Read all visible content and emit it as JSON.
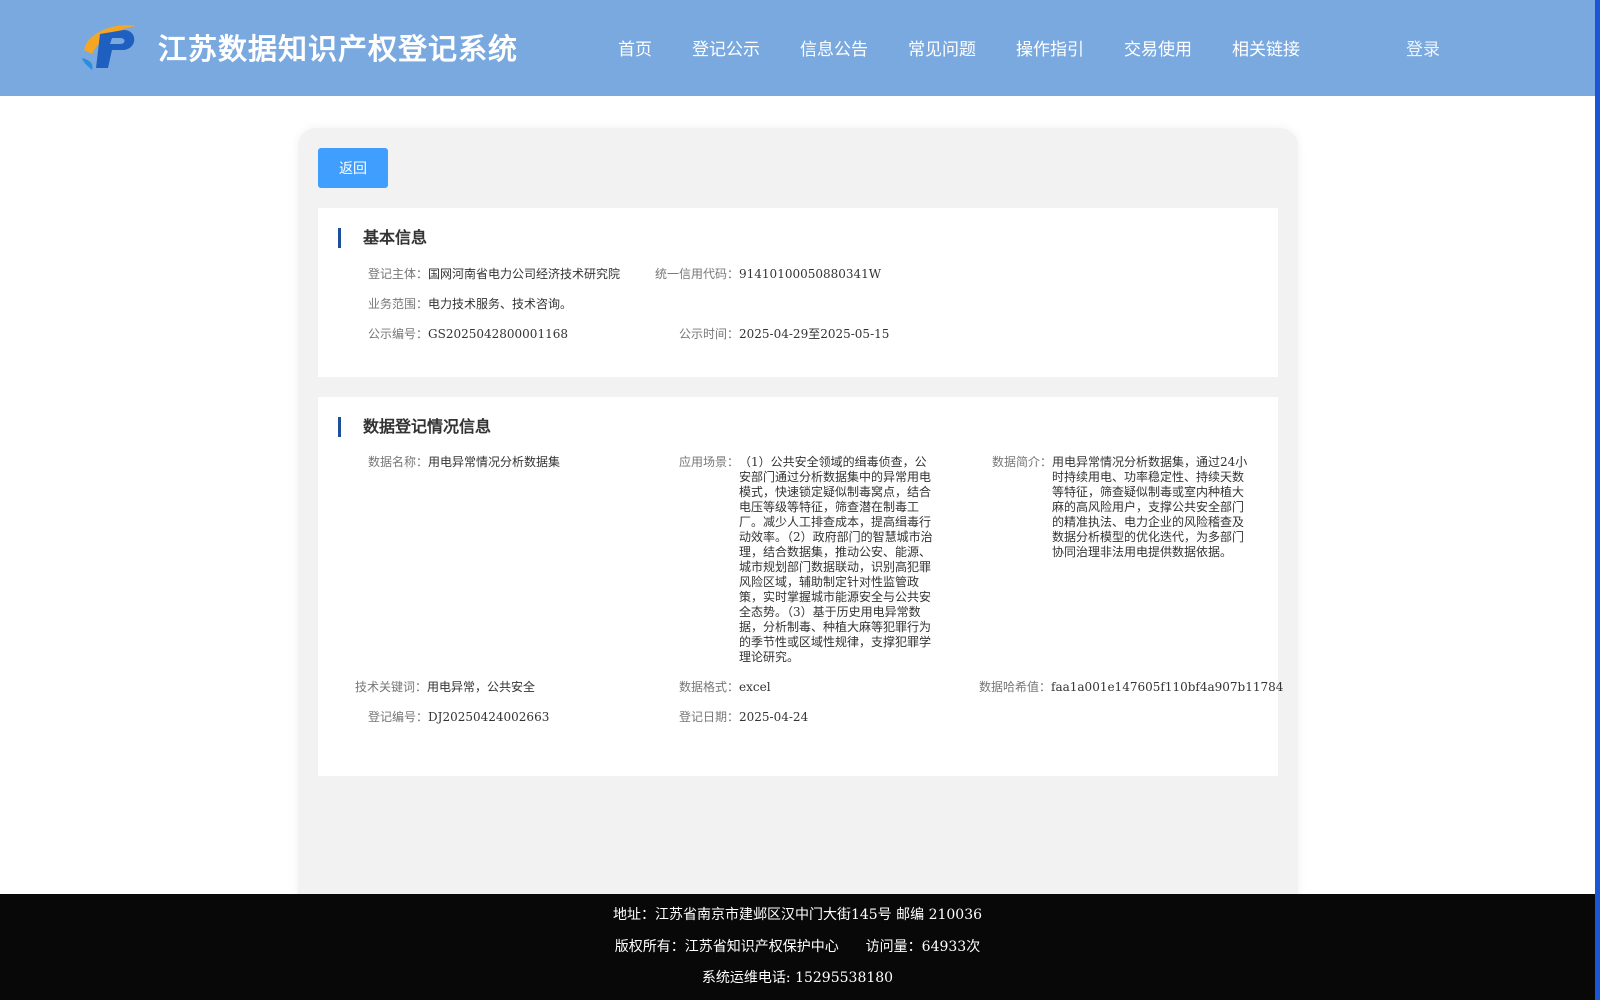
{
  "header": {
    "title": "江苏数据知识产权登记系统",
    "nav": [
      "首页",
      "登记公示",
      "信息公告",
      "常见问题",
      "操作指引",
      "交易使用",
      "相关链接"
    ],
    "login": "登录"
  },
  "back_label": "返回",
  "basic": {
    "title": "基本信息",
    "subject_label": "登记主体：",
    "subject": "国网河南省电力公司经济技术研究院",
    "credit_label": "统一信用代码：",
    "credit": "91410100050880341W",
    "scope_label": "业务范围：",
    "scope": "电力技术服务、技术咨询。",
    "pub_no_label": "公示编号：",
    "pub_no": "GS2025042800001168",
    "pub_time_label": "公示时间：",
    "pub_time": "2025-04-29至2025-05-15"
  },
  "data_reg": {
    "title": "数据登记情况信息",
    "name_label": "数据名称：",
    "name": "用电异常情况分析数据集",
    "scene_label": "应用场景：",
    "scene": "（1）公共安全领域的缉毒侦查，公安部门通过分析数据集中的异常用电模式，快速锁定疑似制毒窝点，结合电压等级等特征，筛查潜在制毒工厂。减少人工排查成本，提高缉毒行动效率。（2）政府部门的智慧城市治理，结合数据集，推动公安、能源、城市规划部门数据联动，识别高犯罪风险区域，辅助制定针对性监管政策，实时掌握城市能源安全与公共安全态势。（3）基于历史用电异常数据，分析制毒、种植大麻等犯罪行为的季节性或区域性规律，支撑犯罪学理论研究。",
    "intro_label": "数据简介：",
    "intro": "用电异常情况分析数据集，通过24小时持续用电、功率稳定性、持续天数等特征，筛查疑似制毒或室内种植大麻的高风险用户，支撑公共安全部门的精准执法、电力企业的风险稽查及数据分析模型的优化迭代，为多部门协同治理非法用电提供数据依据。",
    "keywords_label": "技术关键词：",
    "keywords": "用电异常，公共安全",
    "format_label": "数据格式：",
    "format": "excel",
    "hash_label": "数据哈希值：",
    "hash": "faa1a001e147605f110bf4a907b11784",
    "reg_no_label": "登记编号：",
    "reg_no": "DJ20250424002663",
    "reg_date_label": "登记日期：",
    "reg_date": "2025-04-24"
  },
  "footer": {
    "address": "地址：江苏省南京市建邺区汉中门大街145号 邮编 210036",
    "copyright": "版权所有：江苏省知识产权保护中心",
    "visits": "访问量：64933次",
    "phone": "系统运维电话: 15295538180"
  },
  "colors": {
    "header_bg": "#7aa9e0",
    "button": "#409eff",
    "title_bar": "#1d4f9c",
    "footer_bg": "#080808"
  }
}
